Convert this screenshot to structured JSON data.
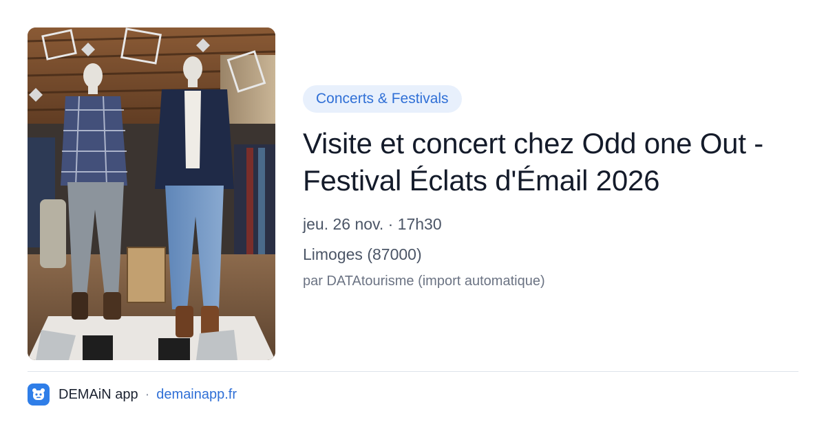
{
  "card": {
    "image_alt": "Mannequins in a clothing shop",
    "category": "Concerts & Festivals",
    "title": "Visite et concert chez Odd one Out - Festival Éclats d'Émail 2026",
    "date_time": "jeu. 26 nov. · 17h30",
    "location": "Limoges (87000)",
    "source": "par DATAtourisme (import automatique)"
  },
  "footer": {
    "app_name": "DEMAiN app",
    "separator": "·",
    "url": "demainapp.fr"
  },
  "colors": {
    "badge_bg": "#e8f0fc",
    "accent": "#2f6fd6",
    "app_icon": "#2f7ee8",
    "title": "#141b2a",
    "meta": "#4b5566",
    "divider": "#dde3ea"
  },
  "icons": {
    "app_icon": "demain-app-icon"
  }
}
